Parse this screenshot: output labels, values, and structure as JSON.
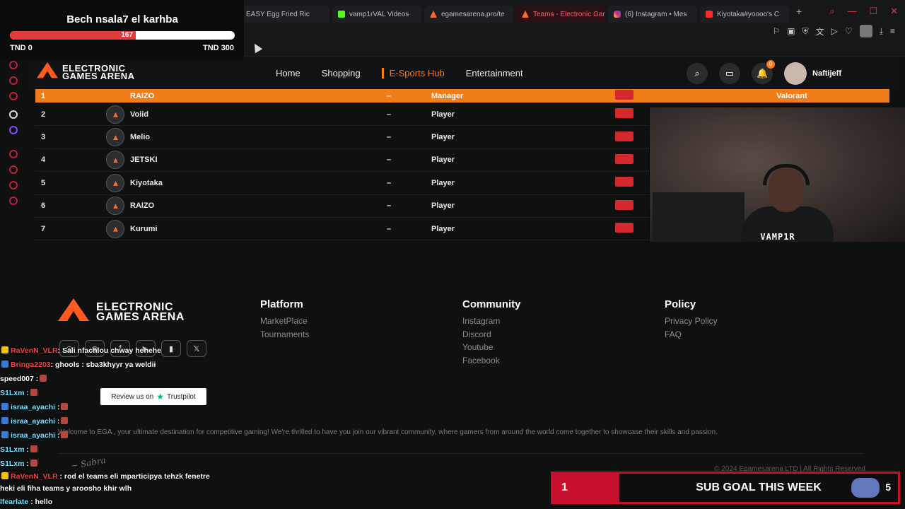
{
  "browser": {
    "tabs": [
      {
        "label": "EASY Egg Fried Ric",
        "fav": "none"
      },
      {
        "label": "vamp1rVAL Videos",
        "fav": "k"
      },
      {
        "label": "egamesarena.pro/te",
        "fav": "ega"
      },
      {
        "label": "Teams - Electronic Game",
        "fav": "ega",
        "active": true
      },
      {
        "label": "(6) Instagram • Mes",
        "fav": "ig"
      },
      {
        "label": "Kiyotaka#yoooo's C",
        "fav": "yt"
      }
    ],
    "new_tab": "+",
    "window_controls": [
      "search-icon",
      "minimize-icon",
      "maximize-icon",
      "close-icon"
    ]
  },
  "donation": {
    "title": "Bech nsala7 el karhba",
    "current": "167",
    "progress_fraction": 0.56,
    "min_label": "TND 0",
    "max_label": "TND 300"
  },
  "site": {
    "logo_line1": "ELECTRONIC",
    "logo_line2": "GAMES ARENA",
    "nav": [
      "Home",
      "Shopping",
      "E-Sports Hub",
      "Entertainment"
    ],
    "active_nav": "E-Sports Hub",
    "notif_count": "0",
    "username": "Naftijeff"
  },
  "table": {
    "rows": [
      {
        "num": "1",
        "name": "RAIZO",
        "dash": "–",
        "role": "Manager",
        "game": "Valorant",
        "highlight": true
      },
      {
        "num": "2",
        "name": "Voiid",
        "dash": "–",
        "role": "Player",
        "game": ""
      },
      {
        "num": "3",
        "name": "Melio",
        "dash": "–",
        "role": "Player",
        "game": ""
      },
      {
        "num": "4",
        "name": "JETSKI",
        "dash": "–",
        "role": "Player",
        "game": ""
      },
      {
        "num": "5",
        "name": "Kiyotaka",
        "dash": "–",
        "role": "Player",
        "game": ""
      },
      {
        "num": "6",
        "name": "RAIZO",
        "dash": "–",
        "role": "Player",
        "game": ""
      },
      {
        "num": "7",
        "name": "Kurumi",
        "dash": "–",
        "role": "Player",
        "game": ""
      }
    ]
  },
  "webcam": {
    "label": "VAMP1R"
  },
  "footer": {
    "logo_line1": "ELECTRONIC",
    "logo_line2": "GAMES ARENA",
    "platform_title": "Platform",
    "platform_links": [
      "MarketPlace",
      "Tournaments"
    ],
    "community_title": "Community",
    "community_links": [
      "Instagram",
      "Discord",
      "Youtube",
      "Facebook"
    ],
    "policy_title": "Policy",
    "policy_links": [
      "Privacy Policy",
      "FAQ"
    ],
    "trustpilot_text": "Review us on",
    "trustpilot_brand": "Trustpilot",
    "welcome": "Welcome to EGA , your ultimate destination for competitive gaming! We're thrilled to have you join our vibrant community, where gamers from around the world come together to showcase their skills and passion.",
    "copyright": "© 2024 Egamesarena LTD | All Rights Reserved"
  },
  "chat": [
    {
      "user": "RaVenN_VLR",
      "color": "#e5484d",
      "badge": "#f5c400",
      "text": ": Sali nfachlou chway hehehe",
      "emote": false
    },
    {
      "user": "Bringa2203",
      "color": "#e5484d",
      "badge": "#3a7bd5",
      "text": ": ghools : sba3khyyr ya weldii",
      "emote": false
    },
    {
      "user": "speed007",
      "color": "#ffffff",
      "badge": "",
      "text": " :",
      "emote": true
    },
    {
      "user": "S1Lxm",
      "color": "#7de3ff",
      "badge": "",
      "text": " :",
      "emote": true
    },
    {
      "user": "israa_ayachi",
      "color": "#7de3ff",
      "badge": "#3a7bd5",
      "text": " :",
      "emote": true
    },
    {
      "user": "israa_ayachi",
      "color": "#7de3ff",
      "badge": "#3a7bd5",
      "text": " :",
      "emote": true
    },
    {
      "user": "israa_ayachi",
      "color": "#7de3ff",
      "badge": "#3a7bd5",
      "text": " :",
      "emote": true
    },
    {
      "user": "S1Lxm",
      "color": "#7de3ff",
      "badge": "",
      "text": " :",
      "emote": true
    },
    {
      "user": "S1Lxm",
      "color": "#7de3ff",
      "badge": "",
      "text": " :",
      "emote": true
    },
    {
      "user": "RaVenN_VLR",
      "color": "#e5484d",
      "badge": "#f5c400",
      "text": " : rod el teams eli mparticipya tehzk fenetre heki eli fiha teams y aroosho khir wlh",
      "emote": false,
      "multi": true
    },
    {
      "user": "Ifearlate",
      "color": "#7de3ff",
      "badge": "",
      "text": " : hello",
      "emote": false
    }
  ],
  "subgoal": {
    "current": "1",
    "label": "SUB GOAL THIS WEEK",
    "target": "5"
  },
  "colors": {
    "accent": "#ff7a1a",
    "brand_red": "#c8102e",
    "flag_red": "#d4272e"
  }
}
